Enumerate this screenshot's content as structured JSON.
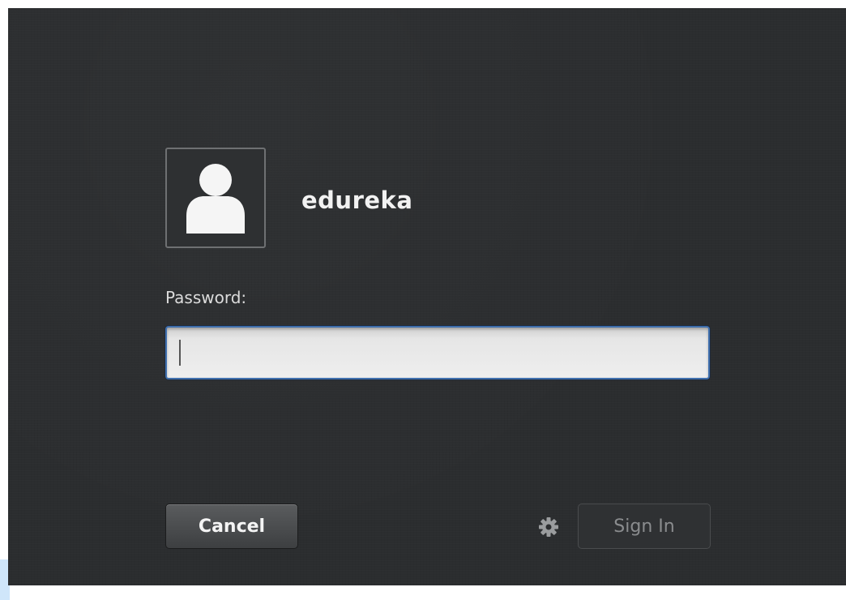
{
  "user": {
    "name": "edureka",
    "avatar_icon": "user-silhouette-icon"
  },
  "password": {
    "label": "Password:",
    "value": "",
    "placeholder": ""
  },
  "buttons": {
    "cancel_label": "Cancel",
    "sign_in_label": "Sign In"
  },
  "icons": {
    "session_options": "gear-icon"
  },
  "colors": {
    "background": "#2b2d2f",
    "focus_border": "#3f6fae",
    "text_primary": "#f2f2f2",
    "text_disabled": "#8a8c8e"
  }
}
